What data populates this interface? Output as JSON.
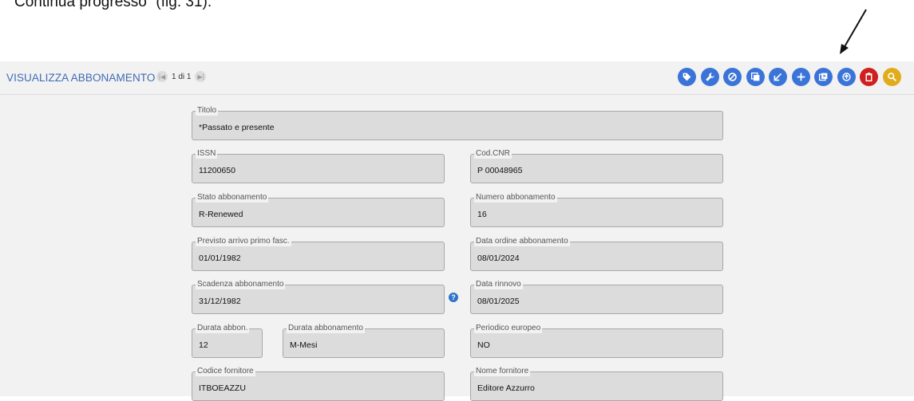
{
  "caption": "Continua progresso” (fig. 31).",
  "app": {
    "title": "VISUALIZZA ABBONAMENTO",
    "pager": {
      "first_icon": "|◀",
      "text": "1 di 1",
      "last_icon": "▶|"
    }
  },
  "toolbar_actions": [
    {
      "name": "tag-icon",
      "color": "#3b74d8"
    },
    {
      "name": "wrench-icon",
      "color": "#3b74d8"
    },
    {
      "name": "block-icon",
      "color": "#3b74d8"
    },
    {
      "name": "copy-icon",
      "color": "#3b74d8"
    },
    {
      "name": "arrow-down-left-icon",
      "color": "#3b74d8"
    },
    {
      "name": "plus-icon",
      "color": "#3b74d8"
    },
    {
      "name": "continue-progress-icon",
      "color": "#3b74d8"
    },
    {
      "name": "upload-icon",
      "color": "#3b74d8"
    },
    {
      "name": "trash-icon",
      "color": "#cf1f1f"
    },
    {
      "name": "search-icon",
      "color": "#e1ac1c"
    }
  ],
  "fields": {
    "titolo": {
      "label": "Titolo",
      "value": "*Passato e presente"
    },
    "issn": {
      "label": "ISSN",
      "value": "11200650"
    },
    "cod_cnr": {
      "label": "Cod.CNR",
      "value": "P 00048965"
    },
    "stato": {
      "label": "Stato abbonamento",
      "value": "R-Renewed"
    },
    "numero": {
      "label": "Numero abbonamento",
      "value": "16"
    },
    "previsto": {
      "label": "Previsto arrivo primo fasc.",
      "value": "01/01/1982"
    },
    "data_ordine": {
      "label": "Data ordine abbonamento",
      "value": "08/01/2024"
    },
    "scadenza": {
      "label": "Scadenza abbonamento",
      "value": "31/12/1982"
    },
    "data_rinnovo": {
      "label": "Data rinnovo",
      "value": "08/01/2025"
    },
    "durata_num": {
      "label": "Durata abbon.",
      "value": "12"
    },
    "durata_unit": {
      "label": "Durata abbonamento",
      "value": "M-Mesi"
    },
    "periodico": {
      "label": "Periodico europeo",
      "value": "NO"
    },
    "codice_fornitore": {
      "label": "Codice fornitore",
      "value": "ITBOEAZZU"
    },
    "nome_fornitore": {
      "label": "Nome fornitore",
      "value": "Editore Azzurro"
    }
  },
  "help_icon": "?"
}
